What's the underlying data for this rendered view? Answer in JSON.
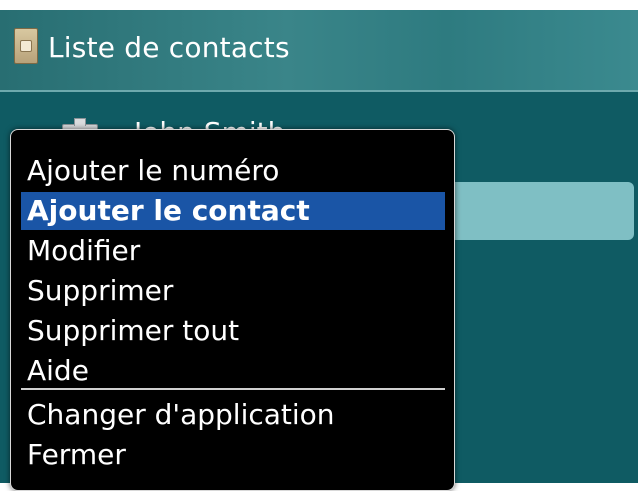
{
  "app": {
    "title": "Liste de contacts",
    "icon": "address-book-icon"
  },
  "contacts": [
    {
      "name": "John Smith",
      "icon": "contact-card-icon"
    }
  ],
  "menu": {
    "items": [
      "Ajouter le numéro",
      "Ajouter le contact",
      "Modifier",
      "Supprimer",
      "Supprimer tout",
      "Aide"
    ],
    "highlighted_index": 1,
    "secondary_items": [
      "Changer d'application",
      "Fermer"
    ]
  },
  "colors": {
    "background": "#0f5b63",
    "titlebar": "#3a8589",
    "selection": "#7fbfc4",
    "menu_highlight": "#1a55a6"
  }
}
